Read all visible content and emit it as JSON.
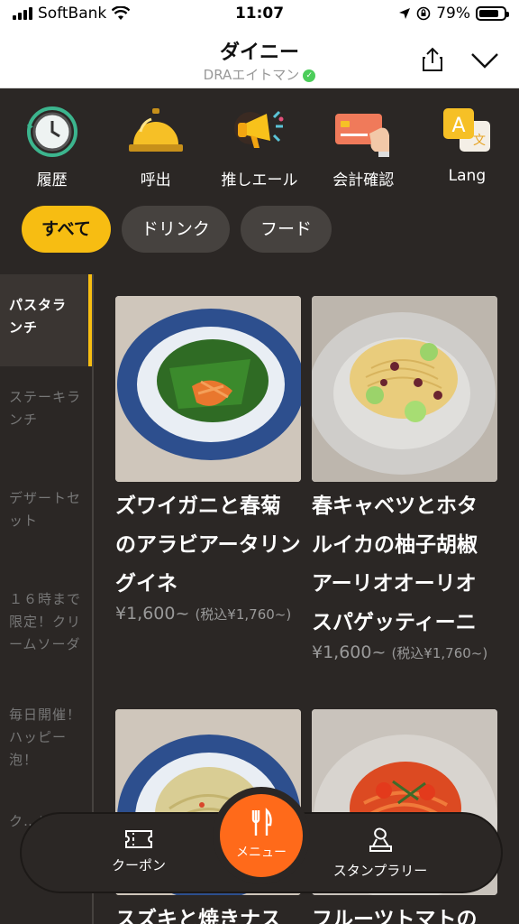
{
  "status": {
    "carrier": "SoftBank",
    "time": "11:07",
    "battery": "79%",
    "battery_level": 0.79
  },
  "header": {
    "title": "ダイニー",
    "subtitle": "DRAエイトマン",
    "badge": "✓"
  },
  "quick_menu": [
    {
      "label": "履歴",
      "icon": "clock-history-icon"
    },
    {
      "label": "呼出",
      "icon": "service-bell-icon"
    },
    {
      "label": "推しエール",
      "icon": "megaphone-icon"
    },
    {
      "label": "会計確認",
      "icon": "credit-card-icon"
    },
    {
      "label": "Lang",
      "icon": "language-icon",
      "glyph_a": "A",
      "glyph_b": "文"
    }
  ],
  "chips": [
    "すべて",
    "ドリンク",
    "フード"
  ],
  "sidebar": [
    "パスタランチ",
    "ステーキランチ",
    "デザートセット",
    "１６時まで限定！クリームソーダ",
    "毎日開催！ハッピー泡！",
    "ク…ン"
  ],
  "items": [
    {
      "name": "ズワイガニと春菊のアラビアータリングイネ",
      "price": "¥1,600~",
      "tax": "(税込¥1,760~)"
    },
    {
      "name": "春キャベツとホタルイカの柚子胡椒アーリオオーリオ　スパゲッティーニ",
      "price": "¥1,600~",
      "tax": "(税込¥1,760~)"
    },
    {
      "name": "スズキと焼きナス",
      "price": "",
      "tax": ""
    },
    {
      "name": "フルーツトマトの",
      "price": "",
      "tax": ""
    }
  ],
  "bottom_nav": {
    "coupon": "クーポン",
    "menu": "メニュー",
    "stamp": "スタンプラリー"
  },
  "colors": {
    "accent": "#f7bd12",
    "menu_button": "#ff6a1a",
    "background": "#2b2725"
  }
}
